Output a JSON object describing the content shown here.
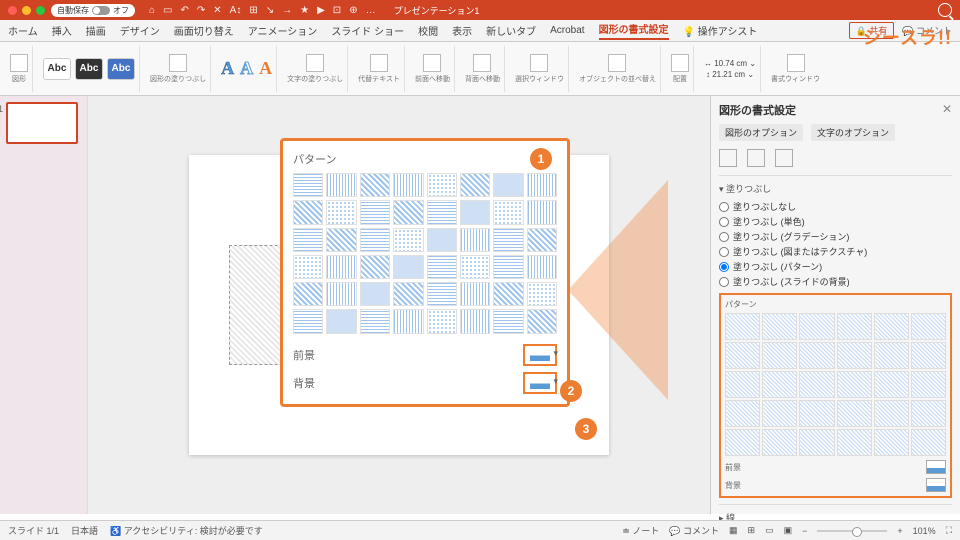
{
  "titlebar": {
    "autosave": "自動保存",
    "off": "オフ",
    "title": "プレゼンテーション1"
  },
  "tabs": {
    "items": [
      "ホーム",
      "挿入",
      "描画",
      "デザイン",
      "画面切り替え",
      "アニメーション",
      "スライド ショー",
      "校閲",
      "表示",
      "新しいタブ",
      "Acrobat",
      "図形の書式設定",
      "操作アシスト"
    ],
    "share": "共有",
    "comment": "コメント"
  },
  "ribbon": {
    "shape": "図形",
    "stylefill": "図形の塗りつぶし",
    "textfill": "文字の塗りつぶし",
    "alt": "代替テキスト",
    "front": "前面へ移動",
    "back": "背面へ移動",
    "selpane": "選択ウィンドウ",
    "align": "オブジェクトの並べ替え",
    "rotate": "配置",
    "w": "10.74 cm",
    "h": "21.21 cm",
    "fmt": "書式ウィンドウ"
  },
  "pane": {
    "title": "図形の書式設定",
    "opt1": "図形のオプション",
    "opt2": "文字のオプション",
    "fill": "塗りつぶし",
    "r1": "塗りつぶしなし",
    "r2": "塗りつぶし (単色)",
    "r3": "塗りつぶし (グラデーション)",
    "r4": "塗りつぶし (図またはテクスチャ)",
    "r5": "塗りつぶし (パターン)",
    "r6": "塗りつぶし (スライドの背景)",
    "pattern": "パターン",
    "fg": "前景",
    "bg": "背景",
    "line": "線"
  },
  "callout": {
    "pattern": "パターン",
    "fg": "前景",
    "bg": "背景"
  },
  "badges": {
    "b1": "1",
    "b2": "2",
    "b3": "3"
  },
  "status": {
    "slide": "スライド 1/1",
    "lang": "日本語",
    "acc": "アクセシビリティ: 検討が必要です",
    "notes": "ノート",
    "comments": "コメント",
    "zoom": "101%"
  },
  "brand": "シースラ!!"
}
